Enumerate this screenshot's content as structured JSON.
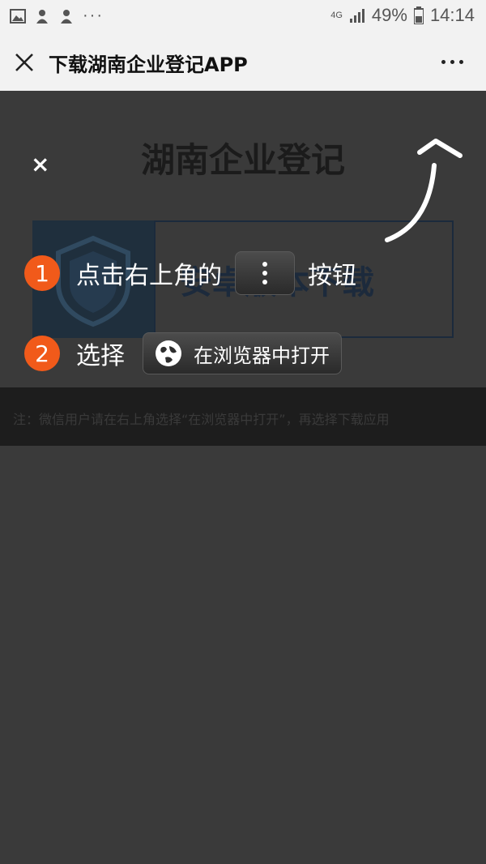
{
  "status_bar": {
    "battery_pct": "49%",
    "time": "14:14",
    "network": "4G",
    "icons": [
      "image-icon",
      "notification-icon",
      "notification-icon",
      "more-dots-icon",
      "signal-icon",
      "battery-icon"
    ]
  },
  "titlebar": {
    "title": "下载湖南企业登记APP",
    "icons": [
      "close-icon",
      "more-icon"
    ]
  },
  "page": {
    "title": "湖南企业登记",
    "close_label": "×",
    "banner_text": "安卓版本下载",
    "note": "注：微信用户请在右上角选择“在浏览器中打开”，再选择下载应用"
  },
  "overlay": {
    "step1": {
      "num": "1",
      "text_before": "点击右上角的",
      "text_after": "按钮"
    },
    "step2": {
      "num": "2",
      "text": "选择",
      "button_label": "在浏览器中打开"
    }
  },
  "colors": {
    "accent": "#f15a1a",
    "overlay": "#3a3a3a",
    "titlebar": "#f2f2f2"
  }
}
